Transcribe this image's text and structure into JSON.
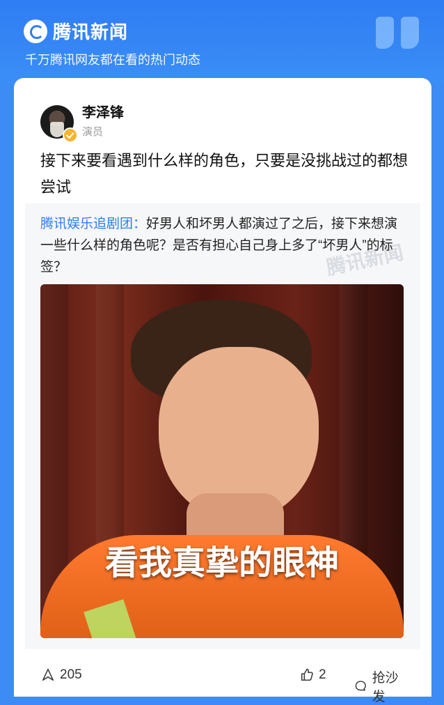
{
  "header": {
    "brand_name": "腾讯新闻",
    "slogan": "千万腾讯网友都在看的热门动态"
  },
  "author": {
    "name": "李泽锋",
    "role": "演员"
  },
  "post": {
    "text": "接下来要看遇到什么样的角色，只要是没挑战过的都想尝试"
  },
  "quote": {
    "source": "腾讯娱乐追剧团：",
    "question": "好男人和坏男人都演过了之后，接下来想演一些什么样的角色呢？是否有担心自己身上多了“坏男人”的标签？",
    "watermark": "腾讯新闻",
    "photo_caption": "看我真挚的眼神"
  },
  "footer": {
    "share_count": "205",
    "like_count": "2",
    "comment_label": "抢沙发"
  }
}
